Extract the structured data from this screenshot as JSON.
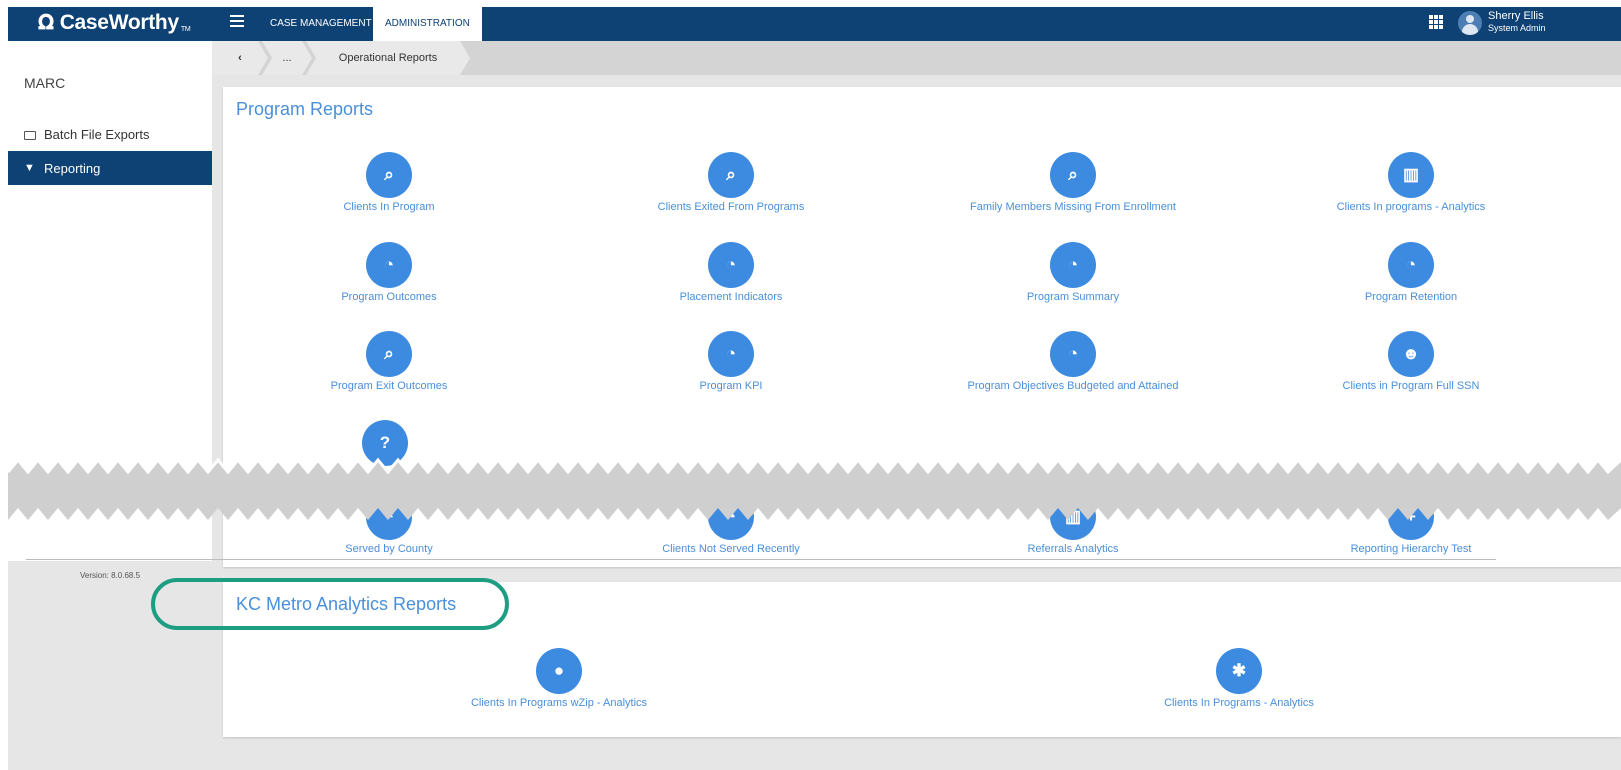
{
  "app": {
    "brand": "CaseWorthy",
    "trademark": "TM"
  },
  "nav": {
    "tabs": [
      "CASE MANAGEMENT",
      "ADMINISTRATION"
    ],
    "active": "ADMINISTRATION"
  },
  "user": {
    "name": "Sherry Ellis",
    "role": "System Admin"
  },
  "sidebar": {
    "org": "MARC",
    "items": [
      {
        "label": "Batch File Exports",
        "icon": "folder-icon"
      },
      {
        "label": "Reporting",
        "icon": "filter-icon",
        "active": true
      }
    ],
    "version": "Version: 8.0.68.5"
  },
  "breadcrumb": {
    "back": "‹",
    "ellipsis": "...",
    "current": "Operational Reports"
  },
  "program_reports": {
    "title": "Program Reports",
    "items": [
      {
        "label": "Clients In Program",
        "icon": "search-icon"
      },
      {
        "label": "Clients Exited From Programs",
        "icon": "search-icon"
      },
      {
        "label": "Family Members Missing From Enrollment",
        "icon": "search-icon"
      },
      {
        "label": "Clients In programs - Analytics",
        "icon": "bar-chart-icon"
      },
      {
        "label": "Program Outcomes",
        "icon": "dashboard-icon"
      },
      {
        "label": "Placement Indicators",
        "icon": "dashboard-icon"
      },
      {
        "label": "Program Summary",
        "icon": "dashboard-icon"
      },
      {
        "label": "Program Retention",
        "icon": "dashboard-icon"
      },
      {
        "label": "Program Exit Outcomes",
        "icon": "search-icon"
      },
      {
        "label": "Program KPI",
        "icon": "dashboard-icon"
      },
      {
        "label": "Program Objectives Budgeted and Attained",
        "icon": "dashboard-icon"
      },
      {
        "label": "Clients in Program Full SSN",
        "icon": "person-icon"
      },
      {
        "label": "Served by County",
        "icon": "dashboard-icon"
      },
      {
        "label": "Clients Not Served Recently",
        "icon": "dashboard-icon"
      },
      {
        "label": "Referrals Analytics",
        "icon": "bar-chart-icon"
      },
      {
        "label": "Reporting Hierarchy Test",
        "icon": "plus-icon"
      }
    ],
    "partial_icon": "question-icon"
  },
  "kc_reports": {
    "title": "KC Metro Analytics Reports",
    "items": [
      {
        "label": "Clients In Programs wZip - Analytics",
        "icon": "globe-icon"
      },
      {
        "label": "Clients In Programs - Analytics",
        "icon": "asterisk-icon"
      }
    ]
  },
  "icons": {
    "search": "⌕",
    "dashboard": "◔",
    "bar_chart": "▥",
    "person": "☻",
    "plus": "+",
    "question": "?",
    "globe": "●",
    "asterisk": "✱"
  },
  "colors": {
    "header": "#0e4174",
    "accent": "#3d8be0",
    "highlight": "#1d9e82"
  }
}
